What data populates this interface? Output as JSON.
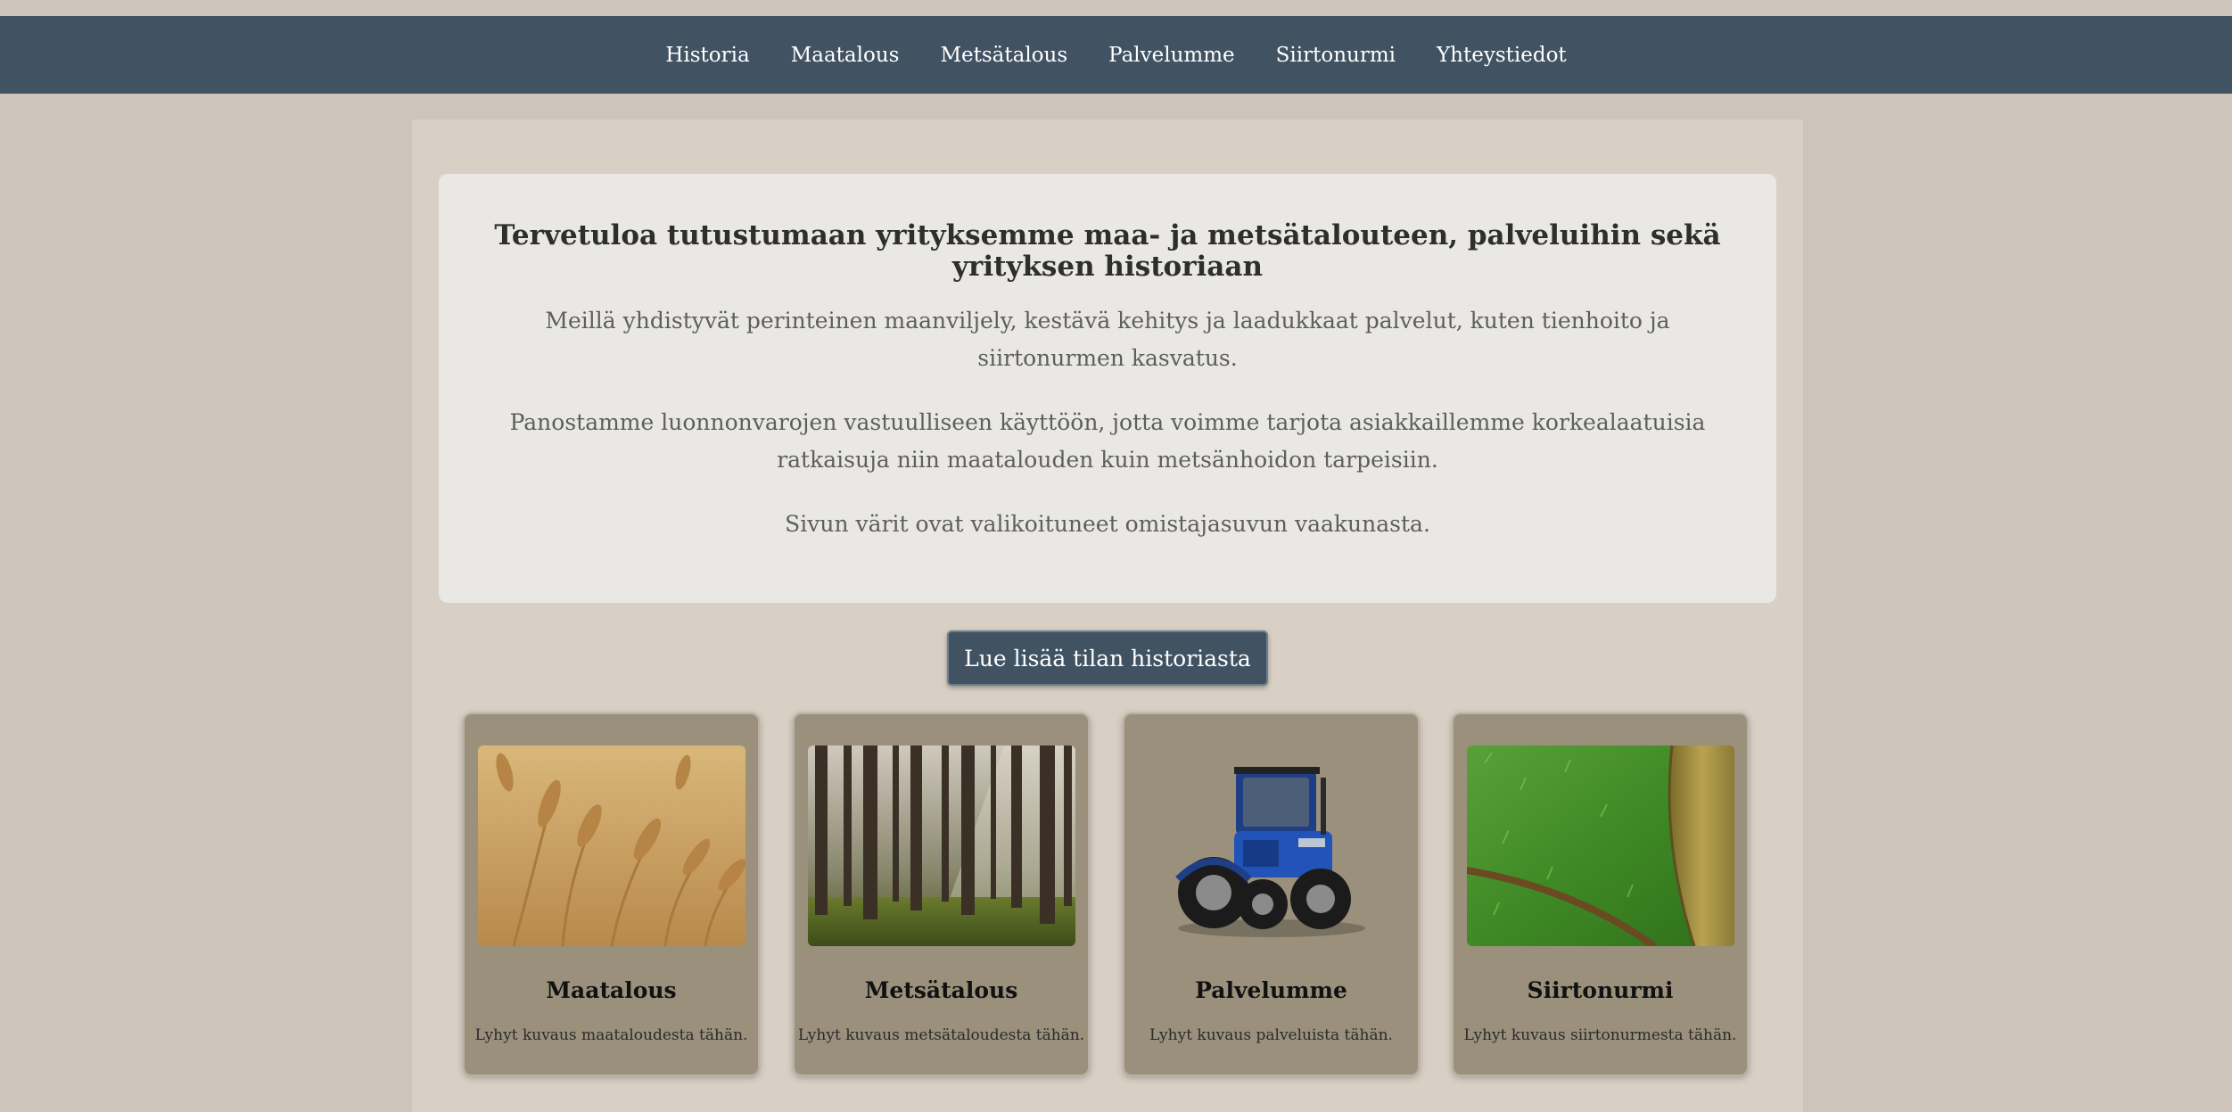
{
  "nav": {
    "items": [
      "Historia",
      "Maatalous",
      "Metsätalous",
      "Palvelumme",
      "Siirtonurmi",
      "Yhteystiedot"
    ]
  },
  "intro": {
    "heading": "Tervetuloa tutustumaan yrityksemme maa- ja metsätalouteen, palveluihin sekä yrityksen historiaan",
    "paragraphs": [
      "Meillä yhdistyvät perinteinen maanviljely, kestävä kehitys ja laadukkaat palvelut, kuten tienhoito ja siirtonurmen kasvatus.",
      "Panostamme luonnonvarojen vastuulliseen käyttöön, jotta voimme tarjota asiakkaillemme korkealaatuisia ratkaisuja niin maatalouden kuin metsänhoidon tarpeisiin.",
      "Sivun värit ovat valikoituneet omistajasuvun vaakunasta."
    ]
  },
  "cta": {
    "label": "Lue lisää tilan historiasta"
  },
  "cards": [
    {
      "title": "Maatalous",
      "description": "Lyhyt kuvaus maataloudesta tähän."
    },
    {
      "title": "Metsätalous",
      "description": "Lyhyt kuvaus metsätaloudesta tähän."
    },
    {
      "title": "Palvelumme",
      "description": "Lyhyt kuvaus palveluista tähän."
    },
    {
      "title": "Siirtonurmi",
      "description": "Lyhyt kuvaus siirtonurmesta tähän."
    }
  ],
  "colors": {
    "nav_background": "#415263",
    "page_background": "#cdc5b9",
    "content_background": "#d9d0c5",
    "intro_background": "#e9e8e4",
    "card_background": "#9a907c"
  }
}
